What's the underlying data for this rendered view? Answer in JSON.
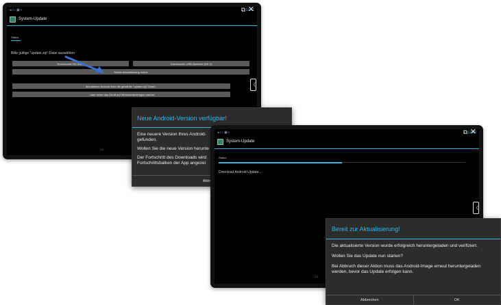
{
  "colors": {
    "accent": "#33b5e5",
    "dialog_bg": "#2c2c2c",
    "screen_bg": "#000000",
    "button_bg": "#5a5a5a"
  },
  "screen1": {
    "status_time": "12:41",
    "app_title": "System-Update",
    "section_label": "Status",
    "prompt": "Bitte gültige \"update.zip\"-Datei auswählen",
    "btn_sd": "Durchsuche SD-Karte",
    "btn_usb": "Durchsuche USB-Speicher (Dir 2)",
    "btn_online": "Suche Aktualisierung online",
    "btn_update_android": "Aktualisiere Android über die gewählte \"update.zip\"-Datei...",
    "btn_factory_reset": "...oder setze das Gerät auf Werkseinstellungen zurück!",
    "window_icon": "restore-window-icon",
    "close_icon": "close-icon",
    "nav_hint": "▭"
  },
  "dialog1": {
    "title": "Neue Android-Version verfügbar!",
    "line1": "Eine neuere Version Ihres Android-",
    "line1b": "gefunden.",
    "line2": "Wollen Sie die neue Version herunte",
    "line3": "Der Fortschritt des Downloads wird",
    "line3b": "Fortschrittsbalken der App angezei",
    "cancel": "Abbrechen"
  },
  "screen2": {
    "status_time": "12:49",
    "app_title": "System-Update",
    "section_label": "Status",
    "message": "Download Android-Update...",
    "progress": 0.5,
    "nav_hint": "▭"
  },
  "dialog2": {
    "title": "Bereit zur Aktualisierung!",
    "p1": "Die aktualisierte Version wurde erfolgreich heruntergeladen und verifiziert.",
    "p2": "Wollen Sie das Update nun starten?",
    "p3": "Bei Abbruch dieser Aktion muss das Android-Image erneut heruntergeladen werden, bevor das Update erfolgen kann.",
    "cancel": "Abbrechen",
    "ok": "OK"
  }
}
